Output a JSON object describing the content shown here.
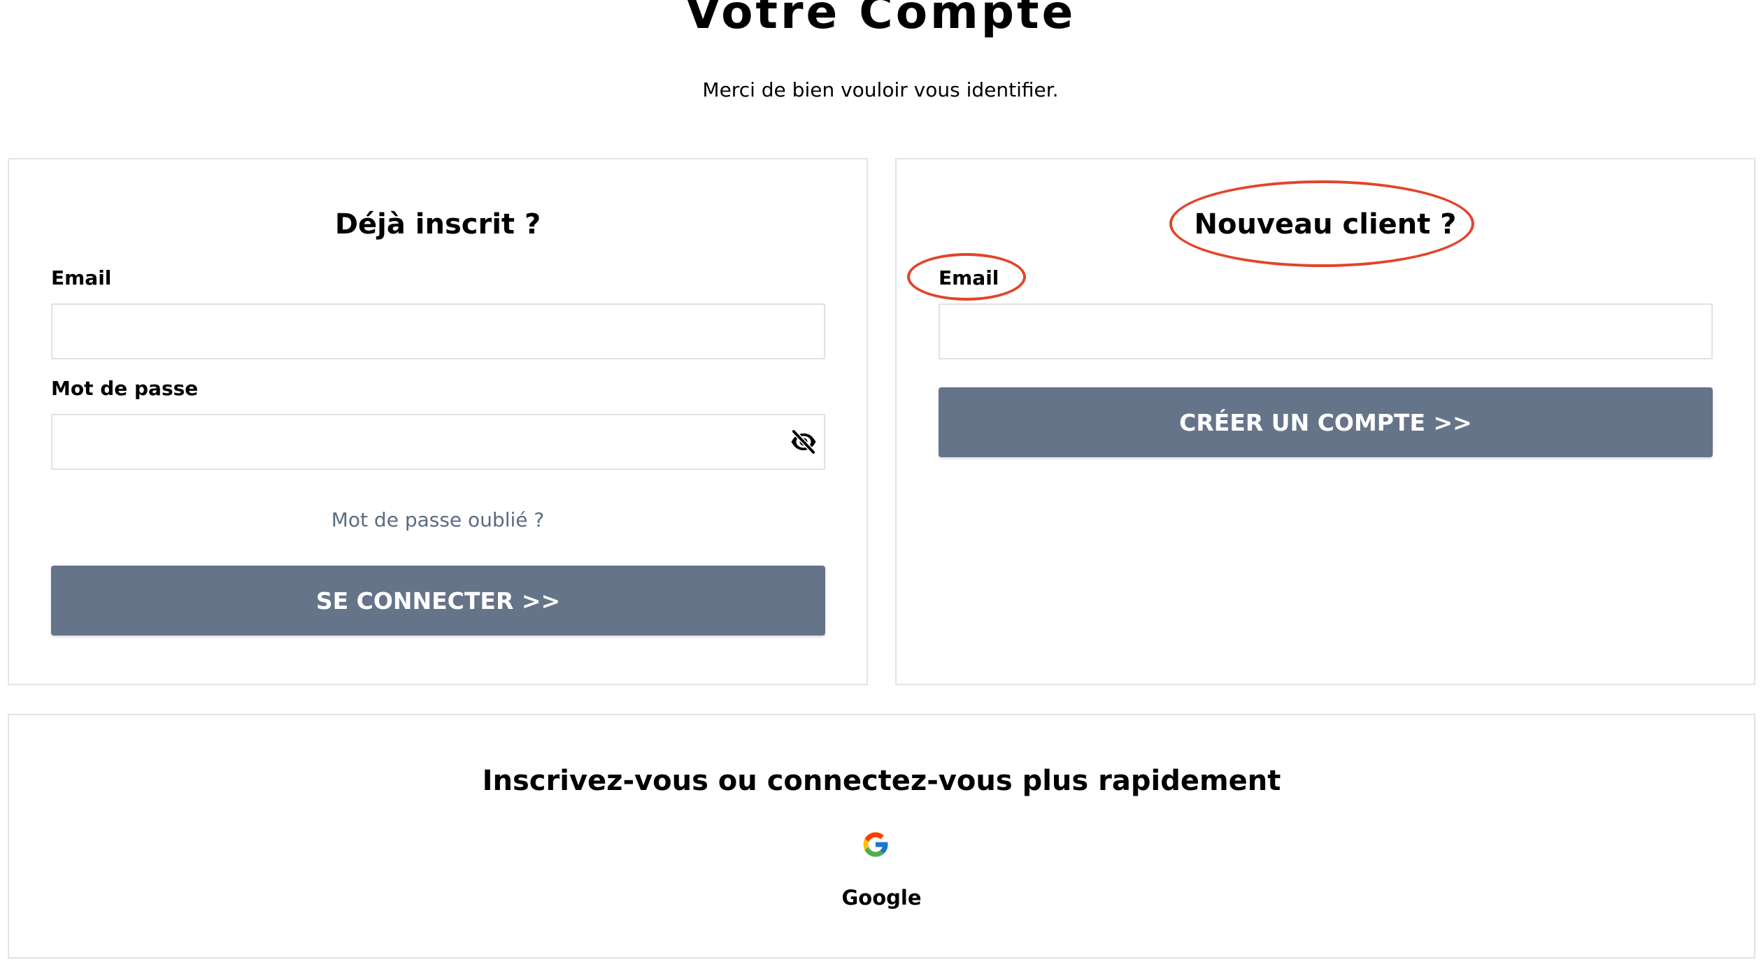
{
  "header": {
    "title": "Votre Compte",
    "subtitle": "Merci de bien vouloir vous identifier."
  },
  "login_panel": {
    "heading": "Déjà inscrit ?",
    "email_label": "Email",
    "email_value": "",
    "password_label": "Mot de passe",
    "password_value": "",
    "password_toggle_icon": "eye-slash-icon",
    "forgot_link": "Mot de passe oublié ?",
    "submit_label": "SE CONNECTER >>"
  },
  "new_client_panel": {
    "heading": "Nouveau client ?",
    "email_label": "Email",
    "email_value": "",
    "submit_label": "CRÉER UN COMPTE >>"
  },
  "social_panel": {
    "heading": "Inscrivez-vous ou connectez-vous plus rapidement",
    "provider_icon": "google-icon",
    "provider_label": "Google"
  },
  "annotations": {
    "color": "#e2442a",
    "highlighted": [
      "Nouveau client ?",
      "Email"
    ]
  },
  "colors": {
    "button": "#66748a",
    "link": "#5b6b82",
    "border": "#e3e3e3"
  }
}
